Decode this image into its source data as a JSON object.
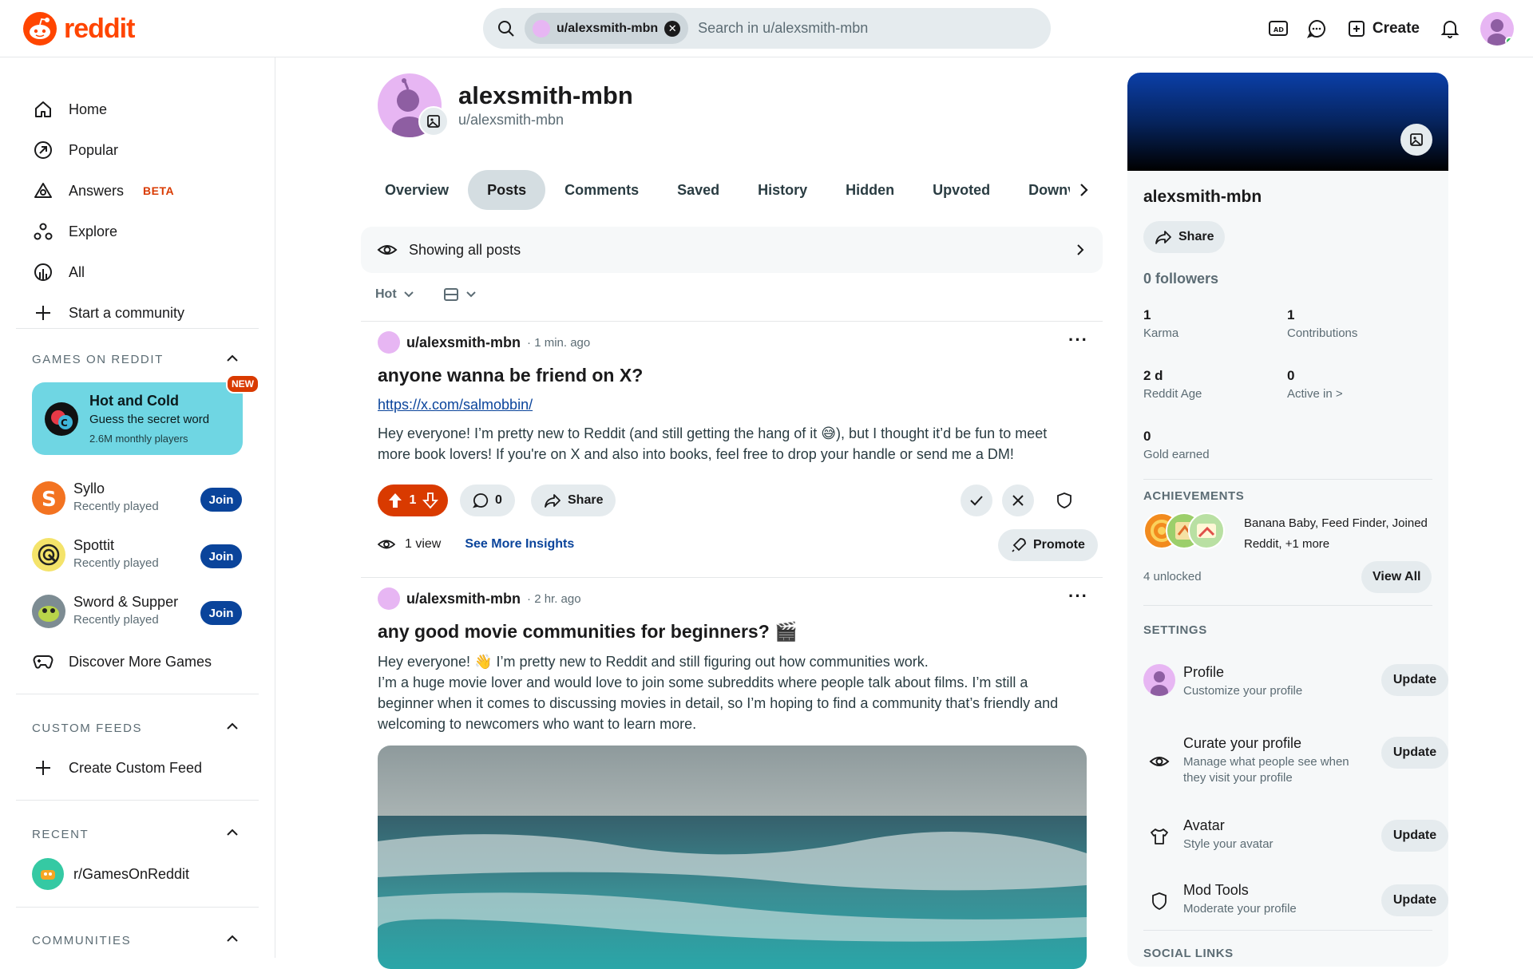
{
  "header": {
    "logo_text": "reddit",
    "search_chip": "u/alexsmith-mbn",
    "search_placeholder": "Search in u/alexsmith-mbn",
    "create_label": "Create",
    "icons": [
      "advertise-icon",
      "chat-icon",
      "plus-square-icon",
      "bell-icon"
    ]
  },
  "sidebar": {
    "nav": [
      {
        "label": "Home",
        "icon": "home-icon"
      },
      {
        "label": "Popular",
        "icon": "popular-icon"
      },
      {
        "label": "Answers",
        "icon": "answers-icon",
        "badge": "BETA"
      },
      {
        "label": "Explore",
        "icon": "explore-icon"
      },
      {
        "label": "All",
        "icon": "all-icon"
      },
      {
        "label": "Start a community",
        "icon": "plus-icon"
      }
    ],
    "games_title": "GAMES ON REDDIT",
    "promo": {
      "title": "Hot and Cold",
      "subtitle": "Guess the secret word",
      "meta": "2.6M monthly players",
      "badge": "NEW"
    },
    "games": [
      {
        "name": "Syllo",
        "sub": "Recently played",
        "join": "Join"
      },
      {
        "name": "Spottit",
        "sub": "Recently played",
        "join": "Join"
      },
      {
        "name": "Sword & Supper",
        "sub": "Recently played",
        "join": "Join"
      }
    ],
    "discover": "Discover More Games",
    "custom_feeds_title": "CUSTOM FEEDS",
    "create_feed": "Create Custom Feed",
    "recent_title": "RECENT",
    "recent_item": "r/GamesOnReddit",
    "communities_title": "COMMUNITIES"
  },
  "profile": {
    "name": "alexsmith-mbn",
    "handle": "u/alexsmith-mbn",
    "tabs": [
      "Overview",
      "Posts",
      "Comments",
      "Saved",
      "History",
      "Hidden",
      "Upvoted",
      "Downvoted"
    ],
    "active_tab": "Posts",
    "showing": "Showing all posts",
    "sort": "Hot"
  },
  "posts": [
    {
      "author": "u/alexsmith-mbn",
      "time": "1 min. ago",
      "title": "anyone wanna be friend on X?",
      "link": "https://x.com/salmobbin/",
      "body": "Hey everyone! I’m pretty new to Reddit (and still getting the hang of it 😅), but I thought it’d be fun to meet more book lovers! If you're on X and also into books, feel free to drop your handle or send me a DM!",
      "votes": "1",
      "comments": "0",
      "share": "Share",
      "views": "1 view",
      "insights": "See More Insights",
      "promote": "Promote"
    },
    {
      "author": "u/alexsmith-mbn",
      "time": "2 hr. ago",
      "title": "any good movie communities for beginners? 🎬",
      "body_lines": [
        "Hey everyone! 👋 I’m pretty new to Reddit and still figuring out how communities work.",
        "I’m a huge movie lover and would love to join some subreddits where people talk about films. I’m still a beginner when it comes to discussing movies in detail, so I’m hoping to find a community that’s friendly and welcoming to newcomers who want to learn more."
      ]
    }
  ],
  "right": {
    "name": "alexsmith-mbn",
    "share": "Share",
    "followers": "0 followers",
    "stats": [
      {
        "value": "1",
        "label": "Karma"
      },
      {
        "value": "1",
        "label": "Contributions"
      },
      {
        "value": "2 d",
        "label": "Reddit Age"
      },
      {
        "value": "0",
        "label": "Active in >"
      },
      {
        "value": "0",
        "label": "Gold earned"
      }
    ],
    "achievements_title": "ACHIEVEMENTS",
    "achievements_text": "Banana Baby, Feed Finder, Joined Reddit, +1 more",
    "unlocked": "4 unlocked",
    "view_all": "View All",
    "settings_title": "SETTINGS",
    "settings": [
      {
        "title": "Profile",
        "sub": "Customize your profile",
        "btn": "Update",
        "icon": "profile-avatar-icon"
      },
      {
        "title": "Curate your profile",
        "sub": "Manage what people see when they visit your profile",
        "btn": "Update",
        "icon": "eye-icon"
      },
      {
        "title": "Avatar",
        "sub": "Style your avatar",
        "btn": "Update",
        "icon": "shirt-icon"
      },
      {
        "title": "Mod Tools",
        "sub": "Moderate your profile",
        "btn": "Update",
        "icon": "shield-icon"
      }
    ],
    "social_links_title": "SOCIAL LINKS"
  },
  "colors": {
    "brand": "#ff4500",
    "join": "#0a449b",
    "vote": "#d93a00",
    "promo": "#6fd6e3"
  }
}
